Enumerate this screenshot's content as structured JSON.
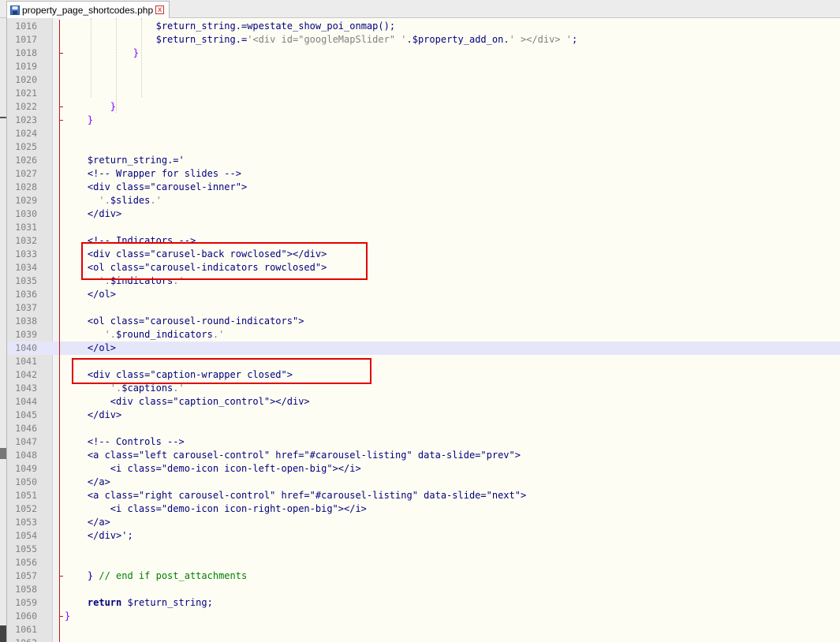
{
  "tab": {
    "label": "property_page_shortcodes.php",
    "icon": "save-icon",
    "close_symbol": "x"
  },
  "colors": {
    "highlight_box": "#e00000",
    "current_line": "#e6e6fa",
    "editor_bg": "#fefdf3",
    "gutter_bg": "#e4e4e4"
  },
  "lines": [
    {
      "n": "1016",
      "text": "                $return_string.=wpestate_show_poi_onmap();"
    },
    {
      "n": "1017",
      "text": "                $return_string.='<div id=\"googleMapSlider\" '.$property_add_on.' ></div> ';"
    },
    {
      "n": "1018",
      "text": "            }"
    },
    {
      "n": "1019",
      "text": ""
    },
    {
      "n": "1020",
      "text": ""
    },
    {
      "n": "1021",
      "text": ""
    },
    {
      "n": "1022",
      "text": "        }"
    },
    {
      "n": "1023",
      "text": "    }"
    },
    {
      "n": "1024",
      "text": ""
    },
    {
      "n": "1025",
      "text": ""
    },
    {
      "n": "1026",
      "text": "    $return_string.='"
    },
    {
      "n": "1027",
      "text": "    <!-- Wrapper for slides -->"
    },
    {
      "n": "1028",
      "text": "    <div class=\"carousel-inner\">"
    },
    {
      "n": "1029",
      "text": "      '.$slides.'"
    },
    {
      "n": "1030",
      "text": "    </div>"
    },
    {
      "n": "1031",
      "text": ""
    },
    {
      "n": "1032",
      "text": "    <!-- Indicators -->"
    },
    {
      "n": "1033",
      "text": "    <div class=\"carusel-back rowclosed\"></div>"
    },
    {
      "n": "1034",
      "text": "    <ol class=\"carousel-indicators rowclosed\">"
    },
    {
      "n": "1035",
      "text": "      '.$indicators.'"
    },
    {
      "n": "1036",
      "text": "    </ol>"
    },
    {
      "n": "1037",
      "text": ""
    },
    {
      "n": "1038",
      "text": "    <ol class=\"carousel-round-indicators\">"
    },
    {
      "n": "1039",
      "text": "       '.$round_indicators.'"
    },
    {
      "n": "1040",
      "text": "    </ol>"
    },
    {
      "n": "1041",
      "text": ""
    },
    {
      "n": "1042",
      "text": "    <div class=\"caption-wrapper closed\">"
    },
    {
      "n": "1043",
      "text": "        '.$captions.'"
    },
    {
      "n": "1044",
      "text": "        <div class=\"caption_control\"></div>"
    },
    {
      "n": "1045",
      "text": "    </div>"
    },
    {
      "n": "1046",
      "text": ""
    },
    {
      "n": "1047",
      "text": "    <!-- Controls -->"
    },
    {
      "n": "1048",
      "text": "    <a class=\"left carousel-control\" href=\"#carousel-listing\" data-slide=\"prev\">"
    },
    {
      "n": "1049",
      "text": "        <i class=\"demo-icon icon-left-open-big\"></i>"
    },
    {
      "n": "1050",
      "text": "    </a>"
    },
    {
      "n": "1051",
      "text": "    <a class=\"right carousel-control\" href=\"#carousel-listing\" data-slide=\"next\">"
    },
    {
      "n": "1052",
      "text": "        <i class=\"demo-icon icon-right-open-big\"></i>"
    },
    {
      "n": "1053",
      "text": "    </a>"
    },
    {
      "n": "1054",
      "text": "    </div>';"
    },
    {
      "n": "1055",
      "text": ""
    },
    {
      "n": "1056",
      "text": ""
    },
    {
      "n": "1057",
      "text": "    } // end if post_attachments"
    },
    {
      "n": "1058",
      "text": ""
    },
    {
      "n": "1059",
      "text": "    return $return_string;"
    },
    {
      "n": "1060",
      "text": "}"
    },
    {
      "n": "1061",
      "text": ""
    },
    {
      "n": "1062",
      "text": ""
    }
  ]
}
